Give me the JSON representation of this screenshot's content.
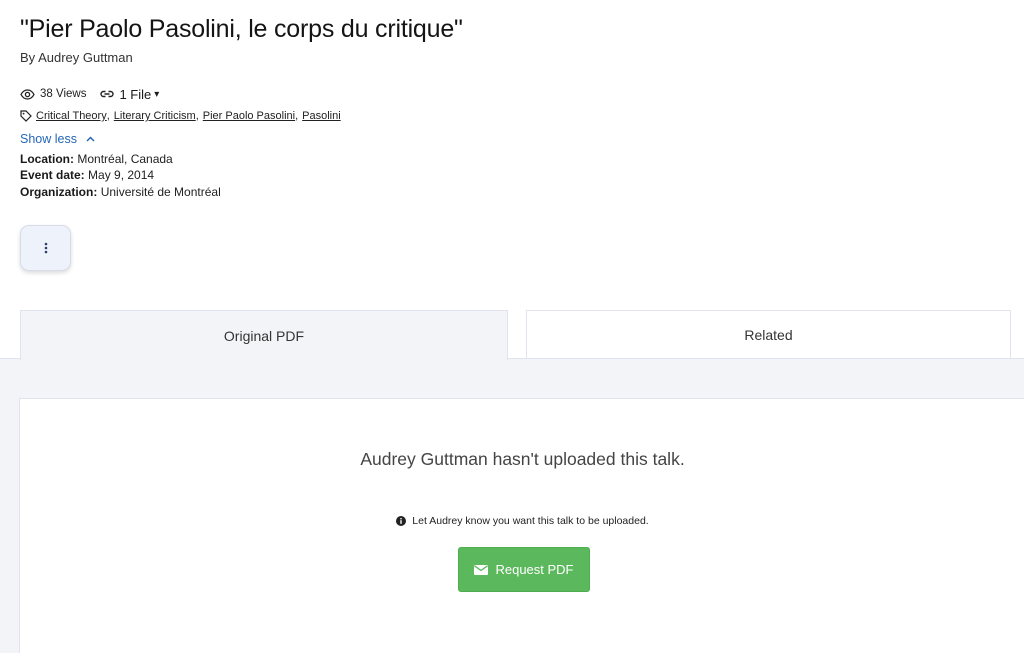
{
  "talk": {
    "title": "\"Pier Paolo Pasolini, le corps du critique\"",
    "byline": "By Audrey Guttman",
    "views": "38 Views",
    "files": "1 File",
    "tags": [
      "Critical Theory",
      "Literary Criticism",
      "Pier Paolo Pasolini",
      "Pasolini"
    ],
    "show_less": "Show less",
    "details": [
      {
        "label": "Location:",
        "value": "Montréal, Canada"
      },
      {
        "label": "Event date:",
        "value": "May 9, 2014"
      },
      {
        "label": "Organization:",
        "value": "Université de Montréal"
      }
    ]
  },
  "tabs": {
    "original_pdf": "Original PDF",
    "related": "Related"
  },
  "panel": {
    "message": "Audrey Guttman hasn't uploaded this talk.",
    "info": "Let Audrey know you want this talk to be uploaded.",
    "request_button": "Request PDF"
  },
  "colors": {
    "link": "#2667b8",
    "request_button": "#5cb85c",
    "tab_background": "#f3f4f8"
  },
  "icons": [
    "eye-icon",
    "link-icon",
    "caret-down-icon",
    "tag-icon",
    "chevron-up-icon",
    "kebab-icon",
    "info-icon",
    "envelope-icon"
  ]
}
